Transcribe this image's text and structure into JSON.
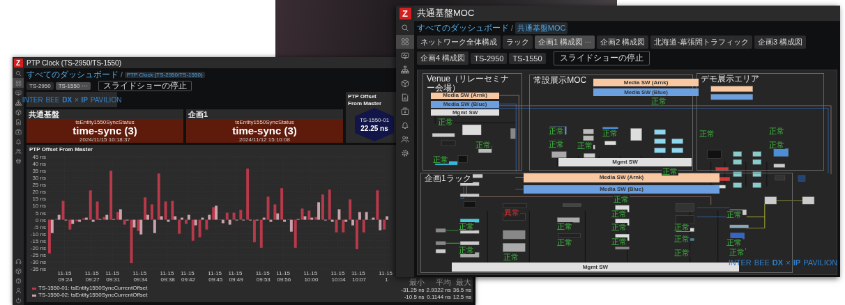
{
  "ptp_window": {
    "logo": "Z",
    "title": "PTP Clock (TS-2950/TS-1550)",
    "sidebar": {
      "items": [
        {
          "kind": "search",
          "selected": false
        },
        {
          "kind": "grid",
          "selected": true
        },
        {
          "kind": "monitor",
          "selected": false
        },
        {
          "kind": "hierarchy",
          "selected": false
        },
        {
          "kind": "cube",
          "selected": false
        },
        {
          "kind": "report",
          "selected": false
        },
        {
          "kind": "tray",
          "selected": false
        },
        {
          "kind": "bell",
          "selected": false
        },
        {
          "kind": "users",
          "selected": false
        },
        {
          "kind": "gear",
          "selected": false
        }
      ],
      "bottom_items": [
        {
          "kind": "headset",
          "selected": false
        },
        {
          "kind": "cube",
          "selected": false
        },
        {
          "kind": "help",
          "selected": false
        },
        {
          "kind": "user",
          "selected": false
        },
        {
          "kind": "power",
          "selected": false
        }
      ]
    },
    "breadcrumb": {
      "root": "すべてのダッシュボード",
      "separator": "/",
      "current": "PTP Clock (TS-2950/TS-1550)"
    },
    "tabs": [
      {
        "label": "TS-2950",
        "selected": false
      },
      {
        "label": "TS-1550",
        "selected": true
      }
    ],
    "slideshow_button": "スライドショーの停止",
    "logo_widget": {
      "text": "INTER BEE **DX** × **IP** PAVILION"
    },
    "problem_widgets": [
      {
        "title": "共通基盤",
        "item": "tsEntity1550SyncStatus",
        "value": "time-sync (3)",
        "time": "2024/11/15 10:18:37"
      },
      {
        "title": "企画1",
        "item": "tsEntity1550SyncStatus",
        "value": "time-sync (3)",
        "time": "2024/11/12 15:10:08"
      }
    ],
    "offset_widget": {
      "title": "PTP Offset From Master",
      "host": "TS-1550-01",
      "value": "22.25 ns"
    },
    "chart_widget": {
      "chart_data": {
        "type": "bar",
        "title": "PTP Offset From Master",
        "grid": true,
        "categories": [
          null,
          null,
          "11-15 09:24",
          null,
          null,
          null,
          "11-15 09:27",
          null,
          null,
          "11-15 09:31",
          null,
          null,
          null,
          "11-15 09:34",
          null,
          null,
          null,
          "11-15 09:38",
          null,
          null,
          "11-15 09:42",
          null,
          null,
          null,
          "11-15 09:45",
          null,
          null,
          "11-15 09:49",
          null,
          null,
          null,
          "11-15 09:53",
          null,
          null,
          "11-15 09:56",
          null,
          null,
          null,
          "11-15 10:00",
          null,
          null,
          null,
          "11-15 10:04",
          null,
          null,
          "11-15 10:07",
          null,
          null,
          null,
          "11-15 1"
        ],
        "series": [
          {
            "name": "TS-1550-01: tsEntity1550SyncCurrentOffset",
            "color": "#b8394a",
            "values": [
              -24,
              0.5,
              13.5,
              -7,
              -1,
              1,
              21,
              13,
              2,
              35,
              5.5,
              -3.5,
              -31,
              -8,
              16,
              11,
              33,
              13,
              13.5,
              -10,
              -3,
              -15,
              -12.5,
              -7,
              9,
              0.3,
              5,
              5,
              7,
              36.5,
              -16,
              -20,
              16.5,
              11,
              22.5,
              0.3,
              -20,
              8,
              6.5,
              2,
              18,
              21.5,
              -9,
              -9,
              14.5,
              -21,
              -9,
              0.3,
              21,
              -7
            ]
          },
          {
            "name": "TS-1550-02: tsEntity1550SyncCurrentOffset",
            "color": "#c9a3ab",
            "values": [
              -9.5,
              3.5,
              -0.5,
              -3,
              -1.5,
              1.5,
              -1.5,
              0.5,
              3.5,
              0.5,
              7.5,
              -0.5,
              -5.5,
              -10.5,
              3.5,
              -9.5,
              2.5,
              -1.5,
              2.5,
              1.5,
              3.5,
              -4,
              1.5,
              3.5,
              10,
              -2.5,
              -3.5,
              -0.5,
              -0.5,
              -0.5,
              -0.5,
              1.5,
              -1.5,
              4.5,
              -1.5,
              -8.5,
              0.5,
              2.5,
              1.5,
              12.5,
              -0.5,
              -1.5,
              7.5,
              -1.5,
              -4,
              5.5,
              5.5,
              1.5,
              -7.5,
              2.5
            ]
          }
        ],
        "ylim": [
          -35,
          45
        ],
        "yticks": [
          {
            "value": 45,
            "label": "45 ns"
          },
          {
            "value": 40,
            "label": "40 ns"
          },
          {
            "value": 35,
            "label": "35 ns"
          },
          {
            "value": 30,
            "label": "30 ns"
          },
          {
            "value": 25,
            "label": "25 ns"
          },
          {
            "value": 20,
            "label": "20 ns"
          },
          {
            "value": 15,
            "label": "15 ns"
          },
          {
            "value": 10,
            "label": "10 ns"
          },
          {
            "value": 5,
            "label": "5 ns"
          },
          {
            "value": 0,
            "label": "0 ns"
          },
          {
            "value": -5,
            "label": "-5 ns"
          },
          {
            "value": -10,
            "label": "-10 ns"
          },
          {
            "value": -15,
            "label": "-15 ns"
          },
          {
            "value": -20,
            "label": "-20 ns"
          },
          {
            "value": -25,
            "label": "-25 ns"
          },
          {
            "value": -30,
            "label": "-30 ns"
          },
          {
            "value": -35,
            "label": "-35 ns"
          }
        ]
      },
      "stats": {
        "columns": [
          "最小",
          "平均",
          "最大"
        ],
        "rows": [
          [
            "-31.25 ns",
            "2.9322 ns",
            "36.5 ns"
          ],
          [
            "-10.5 ns",
            "0.1144 ns",
            "12.5 ns"
          ]
        ]
      }
    }
  },
  "moc_window": {
    "logo": "Z",
    "title": "共通基盤MOC",
    "sidebar": {
      "items": [
        {
          "kind": "search",
          "selected": false
        },
        {
          "kind": "grid",
          "selected": true
        },
        {
          "kind": "monitor",
          "selected": false
        },
        {
          "kind": "hierarchy",
          "selected": false
        },
        {
          "kind": "cube",
          "selected": false
        },
        {
          "kind": "report",
          "selected": false
        },
        {
          "kind": "tray",
          "selected": false
        },
        {
          "kind": "bell",
          "selected": false
        },
        {
          "kind": "users",
          "selected": false
        },
        {
          "kind": "gear",
          "selected": false
        }
      ]
    },
    "breadcrumb": {
      "root": "すべてのダッシュボード",
      "separator": "/",
      "current": "共通基盤MOC"
    },
    "tabs": [
      {
        "label": "ネットワーク全体構成",
        "selected": false
      },
      {
        "label": "ラック",
        "selected": false
      },
      {
        "label": "企画1 構成図",
        "selected": true
      },
      {
        "label": "企画2 構成図",
        "selected": false
      },
      {
        "label": "北海道-幕張間トラフィック",
        "selected": false
      },
      {
        "label": "企画3 構成図",
        "selected": false
      },
      {
        "label": "企画4 構成図",
        "selected": false
      },
      {
        "label": "TS-2950",
        "selected": false
      },
      {
        "label": "TS-1550",
        "selected": false
      }
    ],
    "slideshow_button": "スライドショーの停止",
    "diagram": {
      "sections": [
        {
          "title": "Venue（リレーセミナー会場）"
        },
        {
          "title": "常設展示MOC"
        },
        {
          "title": "デモ展示エリア"
        },
        {
          "title": "企画1ラック"
        }
      ],
      "switches": [
        {
          "label": "Media SW (Arnk)",
          "kind": "arnk"
        },
        {
          "label": "Media SW (Blue)",
          "kind": "blue"
        },
        {
          "label": "Mgmt SW",
          "kind": "mgmt"
        },
        {
          "label": "Media SW (Arnk)",
          "kind": "arnk"
        },
        {
          "label": "Media SW (Blue)",
          "kind": "blue"
        },
        {
          "label": "Mgmt SW",
          "kind": "mgmt"
        },
        {
          "label": "Media SW (Arnk)",
          "kind": "arnk"
        },
        {
          "label": "Media SW (Blue)",
          "kind": "blue"
        },
        {
          "label": "Mgmt SW",
          "kind": "mgmt"
        }
      ],
      "statuses": [
        {
          "text": "正常",
          "ok": true
        },
        {
          "text": "正常",
          "ok": true
        },
        {
          "text": "正常",
          "ok": true
        },
        {
          "text": "正常",
          "ok": true
        },
        {
          "text": "正常",
          "ok": true
        },
        {
          "text": "正常",
          "ok": true
        },
        {
          "text": "正常",
          "ok": true
        },
        {
          "text": "正常",
          "ok": true
        },
        {
          "text": "正常",
          "ok": true
        },
        {
          "text": "正常",
          "ok": true
        },
        {
          "text": "正常",
          "ok": true
        },
        {
          "text": "正常",
          "ok": true
        },
        {
          "text": "正常",
          "ok": true
        },
        {
          "text": "正常",
          "ok": true
        },
        {
          "text": "正常",
          "ok": true
        },
        {
          "text": "正常",
          "ok": true
        },
        {
          "text": "正常",
          "ok": true
        },
        {
          "text": "正常",
          "ok": true
        },
        {
          "text": "正常",
          "ok": true
        },
        {
          "text": "正常",
          "ok": true
        },
        {
          "text": "正常",
          "ok": true
        },
        {
          "text": "正常",
          "ok": true
        },
        {
          "text": "正常",
          "ok": true
        },
        {
          "text": "正常",
          "ok": true
        },
        {
          "text": "正常",
          "ok": true
        },
        {
          "text": "正常",
          "ok": true
        },
        {
          "text": "正常",
          "ok": true
        },
        {
          "text": "異常",
          "ok": false
        }
      ],
      "logo": "INTER BEE **DX** × **IP** PAVILION"
    }
  }
}
